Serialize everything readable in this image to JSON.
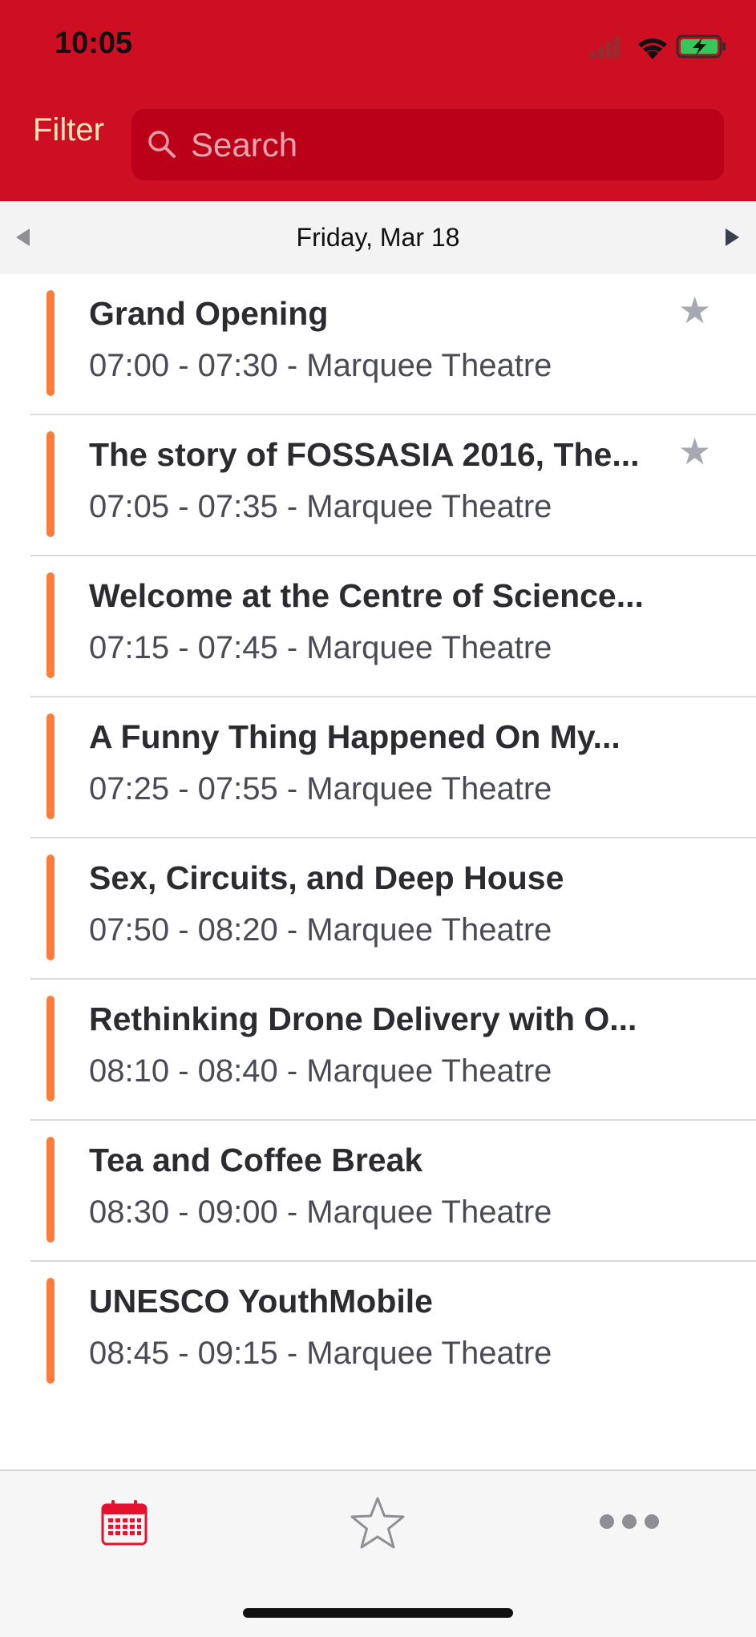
{
  "status_bar": {
    "time": "10:05"
  },
  "header": {
    "filter_label": "Filter",
    "search": {
      "placeholder": "Search",
      "value": ""
    }
  },
  "date_nav": {
    "date_label": "Friday, Mar 18"
  },
  "sessions": [
    {
      "title": "Grand Opening",
      "meta": "07:00 - 07:30 - Marquee Theatre",
      "starred_icon": true
    },
    {
      "title": "The story of FOSSASIA 2016, The...",
      "meta": "07:05 - 07:35 - Marquee Theatre",
      "starred_icon": true
    },
    {
      "title": "Welcome at the Centre of Science...",
      "meta": "07:15 - 07:45 - Marquee Theatre",
      "starred_icon": false
    },
    {
      "title": "A Funny Thing Happened On My...",
      "meta": "07:25 - 07:55 - Marquee Theatre",
      "starred_icon": false
    },
    {
      "title": "Sex, Circuits, and Deep House",
      "meta": "07:50 - 08:20 - Marquee Theatre",
      "starred_icon": false
    },
    {
      "title": "Rethinking Drone Delivery with O...",
      "meta": "08:10 - 08:40 - Marquee Theatre",
      "starred_icon": false
    },
    {
      "title": "Tea and Coffee Break",
      "meta": "08:30 - 09:00 - Marquee Theatre",
      "starred_icon": false
    },
    {
      "title": "UNESCO YouthMobile",
      "meta": "08:45 - 09:15 - Marquee Theatre",
      "starred_icon": false
    }
  ],
  "tabs": [
    {
      "icon": "calendar-icon",
      "active": true
    },
    {
      "icon": "star-outline-icon",
      "active": false
    },
    {
      "icon": "more-icon",
      "active": false
    }
  ],
  "colors": {
    "header_red": "#CE0E22",
    "search_bg": "#BB001A",
    "filter_text": "#FFE7B8",
    "session_bar": "#FB7D3C",
    "active_tab": "#E4112F",
    "inactive_tab": "#8E8E93"
  }
}
